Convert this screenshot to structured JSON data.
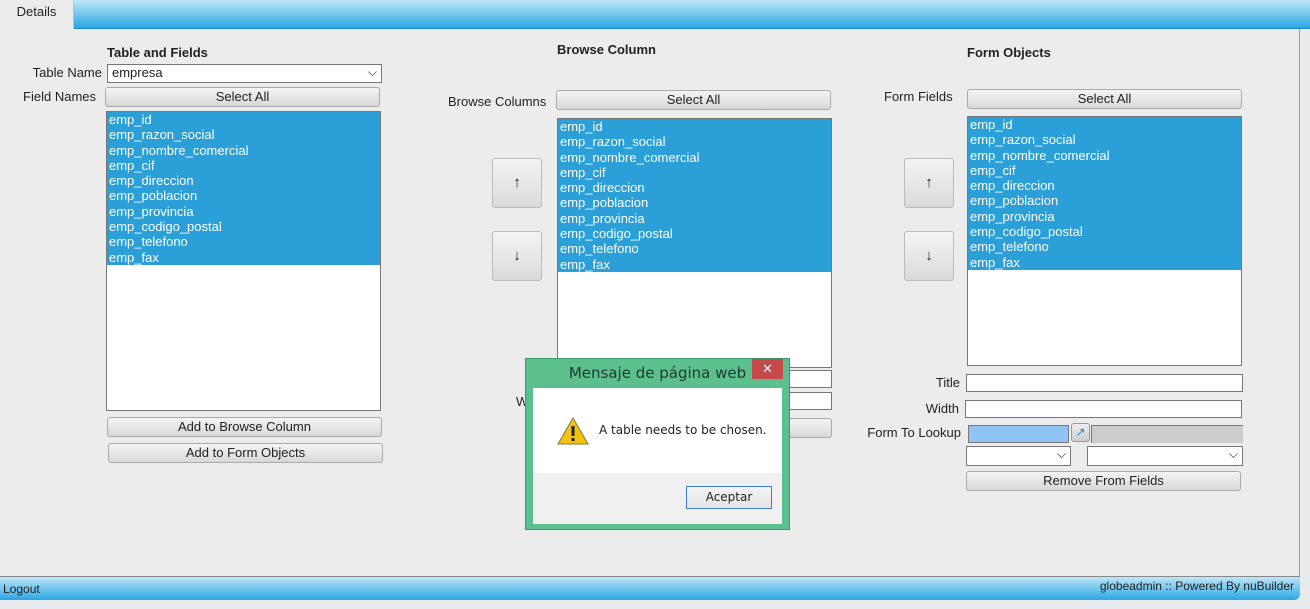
{
  "tabs": [
    {
      "label": "Details",
      "active": true
    }
  ],
  "table_fields": {
    "heading": "Table and Fields",
    "table_name_label": "Table Name",
    "table_name_value": "empresa",
    "field_names_label": "Field Names",
    "select_all": "Select All",
    "add_browse": "Add to Browse Column",
    "add_form": "Add to Form Objects"
  },
  "browse": {
    "heading": "Browse Column",
    "label": "Browse Columns",
    "select_all": "Select All",
    "up": "↑",
    "down": "↓",
    "width_label": "W"
  },
  "form": {
    "heading": "Form Objects",
    "label": "Form Fields",
    "select_all": "Select All",
    "up": "↑",
    "down": "↓",
    "title_label": "Title",
    "width_label": "Width",
    "lookup_label": "Form To Lookup",
    "remove": "Remove From Fields"
  },
  "fields": [
    "emp_id",
    "emp_razon_social",
    "emp_nombre_comercial",
    "emp_cif",
    "emp_direccion",
    "emp_poblacion",
    "emp_provincia",
    "emp_codigo_postal",
    "emp_telefono",
    "emp_fax"
  ],
  "dialog": {
    "title": "Mensaje de página web",
    "message": "A table needs to be chosen.",
    "ok": "Aceptar",
    "close": "✕"
  },
  "footer": {
    "logout": "Logout",
    "powered": "globeadmin :: Powered By nuBuilder"
  },
  "colors": {
    "accent": "#2a9fd8",
    "dialog_frame": "#5cbf8e",
    "close": "#c74a4a"
  }
}
